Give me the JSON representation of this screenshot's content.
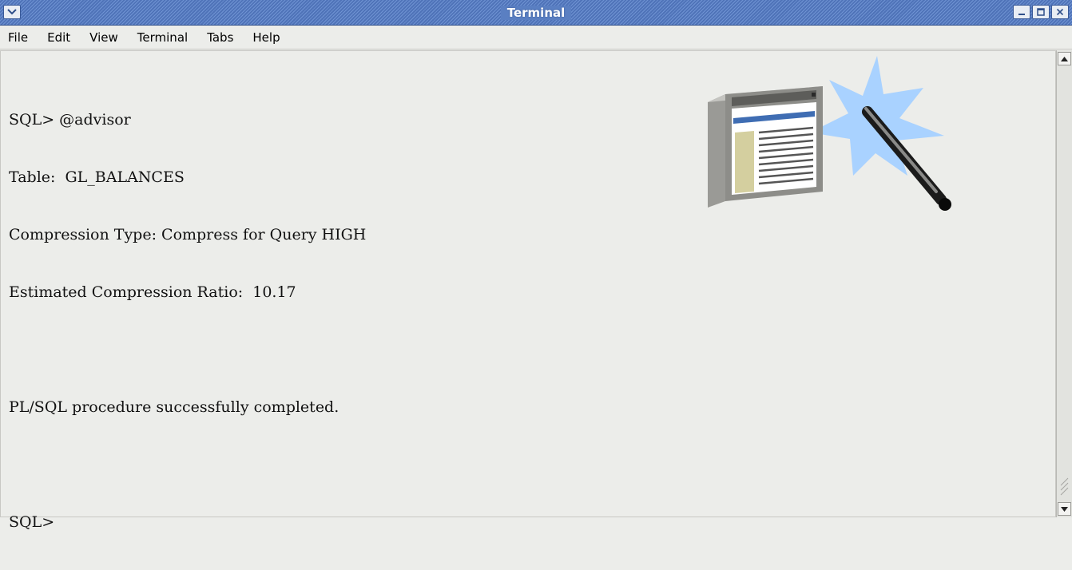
{
  "window": {
    "title": "Terminal"
  },
  "menubar": {
    "items": [
      {
        "label": "File"
      },
      {
        "label": "Edit"
      },
      {
        "label": "View"
      },
      {
        "label": "Terminal"
      },
      {
        "label": "Tabs"
      },
      {
        "label": "Help"
      }
    ]
  },
  "terminal": {
    "lines": [
      "SQL> @advisor",
      "Table:  GL_BALANCES",
      "Compression Type: Compress for Query HIGH",
      "Estimated Compression Ratio:  10.17",
      "",
      "PL/SQL procedure successfully completed.",
      "",
      "SQL>"
    ]
  },
  "icons": {
    "window_menu": "chevron-down-icon",
    "minimize": "minimize-icon",
    "maximize": "maximize-icon",
    "close": "close-icon",
    "scroll_up": "arrow-up-icon",
    "scroll_down": "arrow-down-icon",
    "wizard": "advisor-wizard-icon"
  },
  "colors": {
    "titlebar": "#5a7fc2",
    "background": "#ecedea",
    "text": "#111111",
    "starburst": "#a9d2ff"
  }
}
